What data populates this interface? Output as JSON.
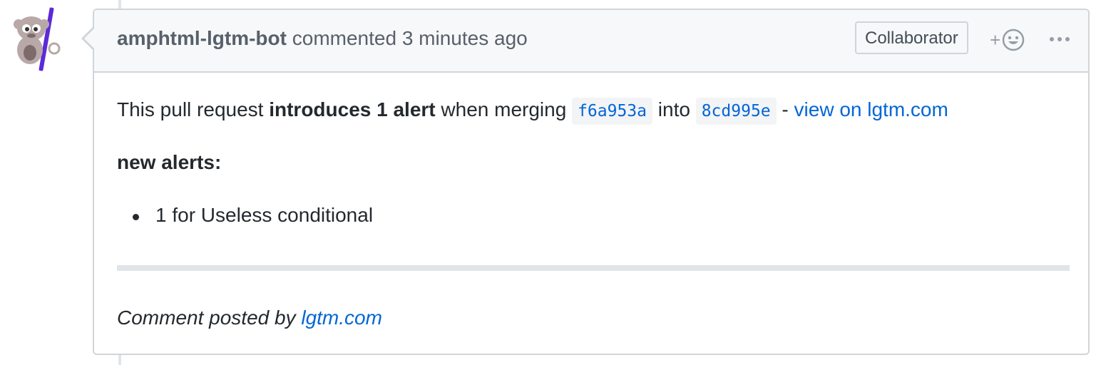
{
  "comment": {
    "author": "amphtml-lgtm-bot",
    "action": "commented",
    "timestamp": "3 minutes ago",
    "badge": "Collaborator",
    "reaction_icon": "smiley-icon",
    "menu_icon": "kebab-horizontal-icon"
  },
  "body": {
    "intro_prefix": "This pull request ",
    "intro_bold": "introduces 1 alert",
    "intro_mid": " when merging ",
    "commit_from": "f6a953a",
    "into_text": " into ",
    "commit_to": "8cd995e",
    "dash_text": " - ",
    "view_link": "view on lgtm.com",
    "new_alerts_heading": "new alerts:",
    "alerts": [
      "1 for Useless conditional"
    ],
    "footer_prefix": "Comment posted by ",
    "footer_link": "lgtm.com"
  },
  "colors": {
    "link": "#0366d6",
    "header_bg": "#f6f8fa",
    "border": "#d1d5da",
    "avatar_bar": "#5b2bd6"
  }
}
